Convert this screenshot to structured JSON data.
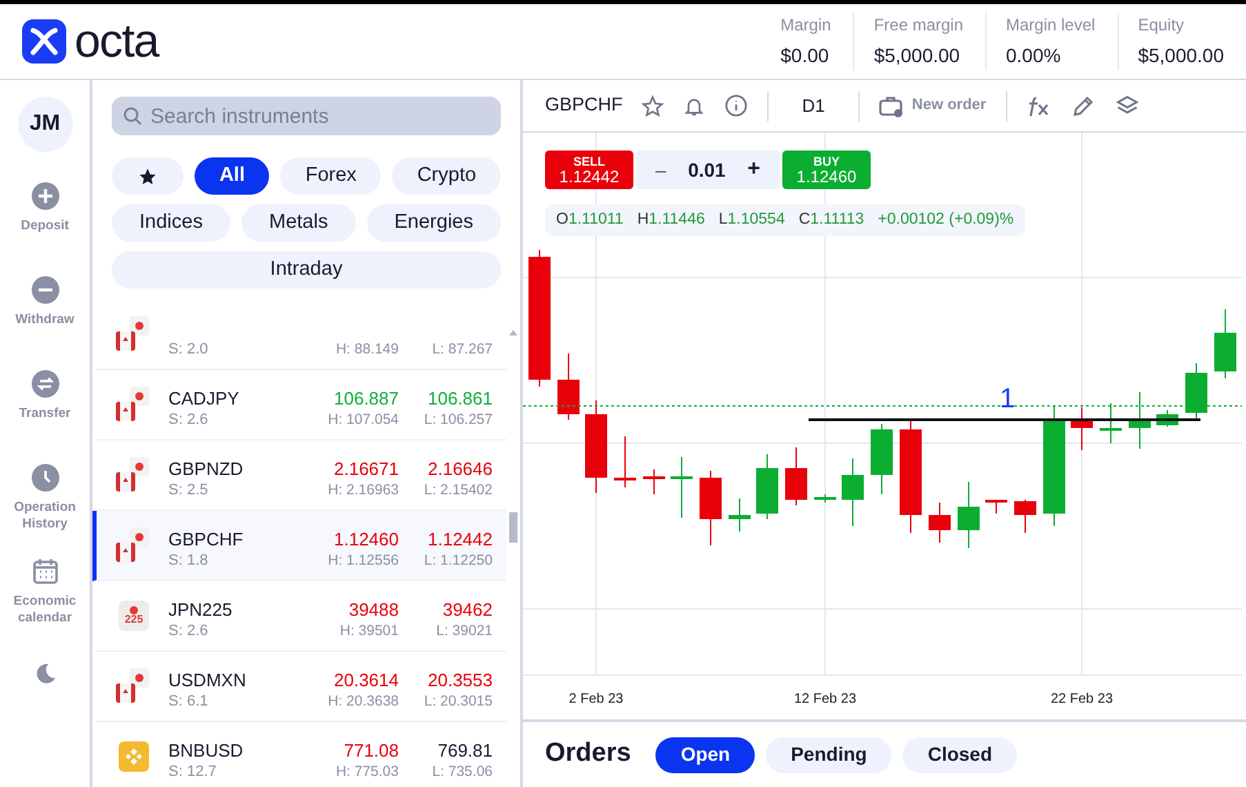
{
  "header": {
    "logo_text": "octa",
    "stats": [
      {
        "label": "Margin",
        "value": "$0.00"
      },
      {
        "label": "Free margin",
        "value": "$5,000.00"
      },
      {
        "label": "Margin level",
        "value": "0.00%"
      },
      {
        "label": "Equity",
        "value": "$5,000.00"
      }
    ]
  },
  "rail": {
    "avatar": "JM",
    "items": [
      {
        "kind": "deposit",
        "label": "Deposit"
      },
      {
        "kind": "withdraw",
        "label": "Withdraw"
      },
      {
        "kind": "transfer",
        "label": "Transfer"
      },
      {
        "kind": "history",
        "label": "Operation History"
      },
      {
        "kind": "calendar",
        "label": "Economic calendar"
      }
    ]
  },
  "instruments": {
    "search": {
      "placeholder": "Search instruments"
    },
    "filter_rows": [
      {
        "chips": [
          {
            "kind": "favorites",
            "selected": false
          },
          {
            "kind": "text",
            "label": "All",
            "selected": true
          },
          {
            "kind": "text",
            "label": "Forex",
            "selected": false
          },
          {
            "kind": "text",
            "label": "Crypto",
            "selected": false
          }
        ]
      },
      {
        "chips": [
          {
            "kind": "text",
            "label": "Indices",
            "selected": false
          },
          {
            "kind": "text",
            "label": "Metals",
            "selected": false
          },
          {
            "kind": "text",
            "label": "Energies",
            "selected": false
          }
        ]
      },
      {
        "chips": [
          {
            "kind": "text",
            "label": "Intraday",
            "selected": false
          }
        ]
      }
    ],
    "rows": [
      {
        "kind": "pair",
        "spread": "S: 2.0",
        "high": "H: 88.149",
        "low": "L: 87.267",
        "selected": false
      },
      {
        "kind": "pair",
        "name": "CADJPY",
        "spread": "S: 2.6",
        "bid": {
          "value": "106.887",
          "color": "#0fae3a"
        },
        "ask": {
          "value": "106.861",
          "color": "#0fae3a"
        },
        "high": "H: 107.054",
        "low": "L: 106.257",
        "selected": false
      },
      {
        "kind": "pair",
        "name": "GBPNZD",
        "spread": "S: 2.5",
        "bid": {
          "value": "2.16671",
          "color": "#e8000b"
        },
        "ask": {
          "value": "2.16646",
          "color": "#e8000b"
        },
        "high": "H: 2.16963",
        "low": "L: 2.15402",
        "selected": false
      },
      {
        "kind": "pair",
        "name": "GBPCHF",
        "spread": "S: 1.8",
        "bid": {
          "value": "1.12460",
          "color": "#e8000b"
        },
        "ask": {
          "value": "1.12442",
          "color": "#e8000b"
        },
        "high": "H: 1.12556",
        "low": "L: 1.12250",
        "selected": true
      },
      {
        "kind": "index",
        "name": "JPN225",
        "icon_text": "225",
        "spread": "S: 2.6",
        "bid": {
          "value": "39488",
          "color": "#e8000b"
        },
        "ask": {
          "value": "39462",
          "color": "#e8000b"
        },
        "high": "H: 39501",
        "low": "L: 39021",
        "selected": false
      },
      {
        "kind": "pair",
        "name": "USDMXN",
        "spread": "S: 6.1",
        "bid": {
          "value": "20.3614",
          "color": "#e8000b"
        },
        "ask": {
          "value": "20.3553",
          "color": "#e8000b"
        },
        "high": "H: 20.3638",
        "low": "L: 20.3015",
        "selected": false
      },
      {
        "kind": "crypto",
        "name": "BNBUSD",
        "spread": "S: 12.7",
        "bid": {
          "value": "771.08",
          "color": "#e8000b"
        },
        "ask": {
          "value": "769.81",
          "color": "#1a1a2e"
        },
        "high": "H: 775.03",
        "low": "L: 735.06",
        "selected": false
      }
    ]
  },
  "chart": {
    "symbol": "GBPCHF",
    "timeframe": "D1",
    "new_order": "New order",
    "trade": {
      "sell_label": "SELL",
      "sell_price": "1.12442",
      "minus": "–",
      "volume": "0.01",
      "plus": "+",
      "buy_label": "BUY",
      "buy_price": "1.12460"
    },
    "ohlc": [
      {
        "key": "O",
        "value": "1.11011"
      },
      {
        "key": "H",
        "value": "1.11446"
      },
      {
        "key": "L",
        "value": "1.10554"
      },
      {
        "key": "C",
        "value": "1.11113"
      }
    ],
    "change": "+0.00102 (+0.09)%",
    "line_label": "1",
    "dates": [
      "2 Feb 23",
      "12 Feb 23",
      "22 Feb 23"
    ]
  },
  "orders": {
    "title": "Orders",
    "tabs": [
      {
        "label": "Open",
        "selected": true
      },
      {
        "label": "Pending",
        "selected": false
      },
      {
        "label": "Closed",
        "selected": false
      }
    ]
  }
}
